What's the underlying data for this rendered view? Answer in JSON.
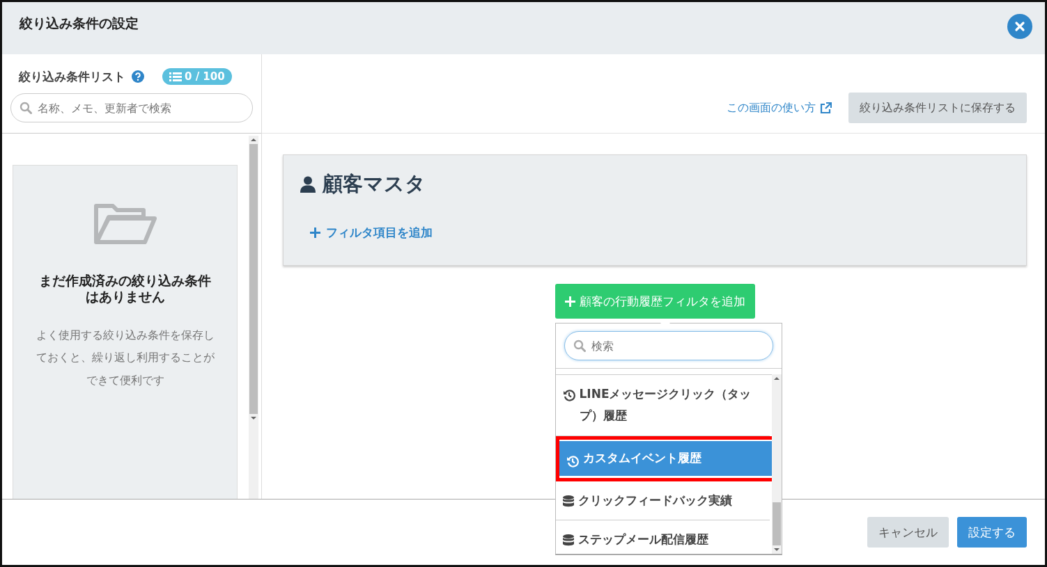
{
  "dialog": {
    "title": "絞り込み条件の設定"
  },
  "sidebar": {
    "title": "絞り込み条件リスト",
    "counter": "0 / 100",
    "search": {
      "placeholder": "名称、メモ、更新者で検索"
    },
    "empty_state": {
      "heading": "まだ作成済みの絞り込み条件はありません",
      "message": "よく使用する絞り込み条件を保存しておくと、繰り返し利用することができて便利です"
    }
  },
  "toolbar": {
    "help_link": "この画面の使い方",
    "save_button": "絞り込み条件リストに保存する"
  },
  "master_card": {
    "title": "顧客マスタ",
    "add_filter_link": "フィルタ項目を追加"
  },
  "behavior_button": {
    "label": "顧客の行動履歴フィルタを追加"
  },
  "dropdown": {
    "search": {
      "placeholder": "検索"
    },
    "items": [
      {
        "kind": "history",
        "label": "LINEメッセージクリック（タップ）履歴",
        "selected": false,
        "annotated": false
      },
      {
        "kind": "history",
        "label": "カスタムイベント履歴",
        "selected": true,
        "annotated": true
      },
      {
        "kind": "database",
        "label": "クリックフィードバック実績",
        "selected": false,
        "annotated": false
      },
      {
        "kind": "database",
        "label": "ステップメール配信履歴",
        "selected": false,
        "annotated": false
      }
    ]
  },
  "footer": {
    "buttons": [
      {
        "kind": "secondary",
        "label": "キャンセル"
      },
      {
        "kind": "primary",
        "label": "設定する"
      }
    ]
  }
}
